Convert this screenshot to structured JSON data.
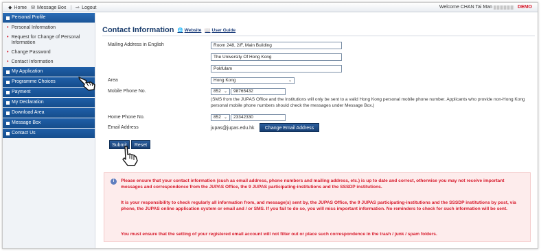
{
  "topbar": {
    "home": "Home",
    "message_box": "Message Box",
    "logout": "Logout",
    "welcome": "Welcome CHAN Tai Man",
    "demo": "DEMO"
  },
  "sidebar": {
    "personal_profile": "Personal Profile",
    "sub_items": [
      "Personal Information",
      "Request for Change of Personal Information",
      "Change Password",
      "Contact Information"
    ],
    "sections": [
      "My Application",
      "Programme Choices",
      "Payment",
      "My Declaration",
      "Download Area",
      "Message Box",
      "Contact Us"
    ]
  },
  "page": {
    "title": "Contact Information",
    "website_link": "Website",
    "user_guide_link": "User Guide"
  },
  "form": {
    "mailing_label": "Mailing Address in English",
    "address_line1": "Room 248, 2/F, Main Building",
    "address_line2": "The University Of Hong Kong",
    "address_line3": "Pokfulam",
    "area_label": "Area",
    "area_value": "Hong Kong",
    "mobile_label": "Mobile Phone No.",
    "mobile_code": "852",
    "mobile_number": "98765432",
    "mobile_note": "(SMS from the JUPAS Office and the Institutions will only be sent to a valid Hong Kong personal mobile phone number. Applicants who provide non-Hong Kong personal mobile phone numbers should check the messages under Message Box.)",
    "home_label": "Home Phone No.",
    "home_code": "852",
    "home_number": "23342330",
    "email_label": "Email Address",
    "email_value": "jupas@jupas.edu.hk",
    "change_email_button": "Change Email Address",
    "submit_button": "Submit",
    "reset_button": "Reset"
  },
  "notice": {
    "para1": "Please ensure that your contact information (such as email address, phone numbers and mailing address, etc.) is up to date and correct, otherwise you may not receive important messages and correspondence from the JUPAS Office, the 9 JUPAS participating-institutions and the SSSDP institutions.",
    "para2": "It is your responsibility to check regularly all information from, and message(s) sent by, the JUPAS Office, the 9 JUPAS participating-institutions and the SSSDP institutions by post, via phone, the JUPAS online application system or email and / or SMS. If you fail to do so, you will miss important information. No reminders to check for such information will be sent.",
    "para3": "You must ensure that the setting of your registered email account will not filter out or place such correspondence in the trash / junk / spam folders."
  },
  "colors": {
    "nav_blue": "#1f5fa8",
    "button_blue": "#1f4c86",
    "alert_red": "#d7192a",
    "notice_bg": "#fdecec"
  }
}
